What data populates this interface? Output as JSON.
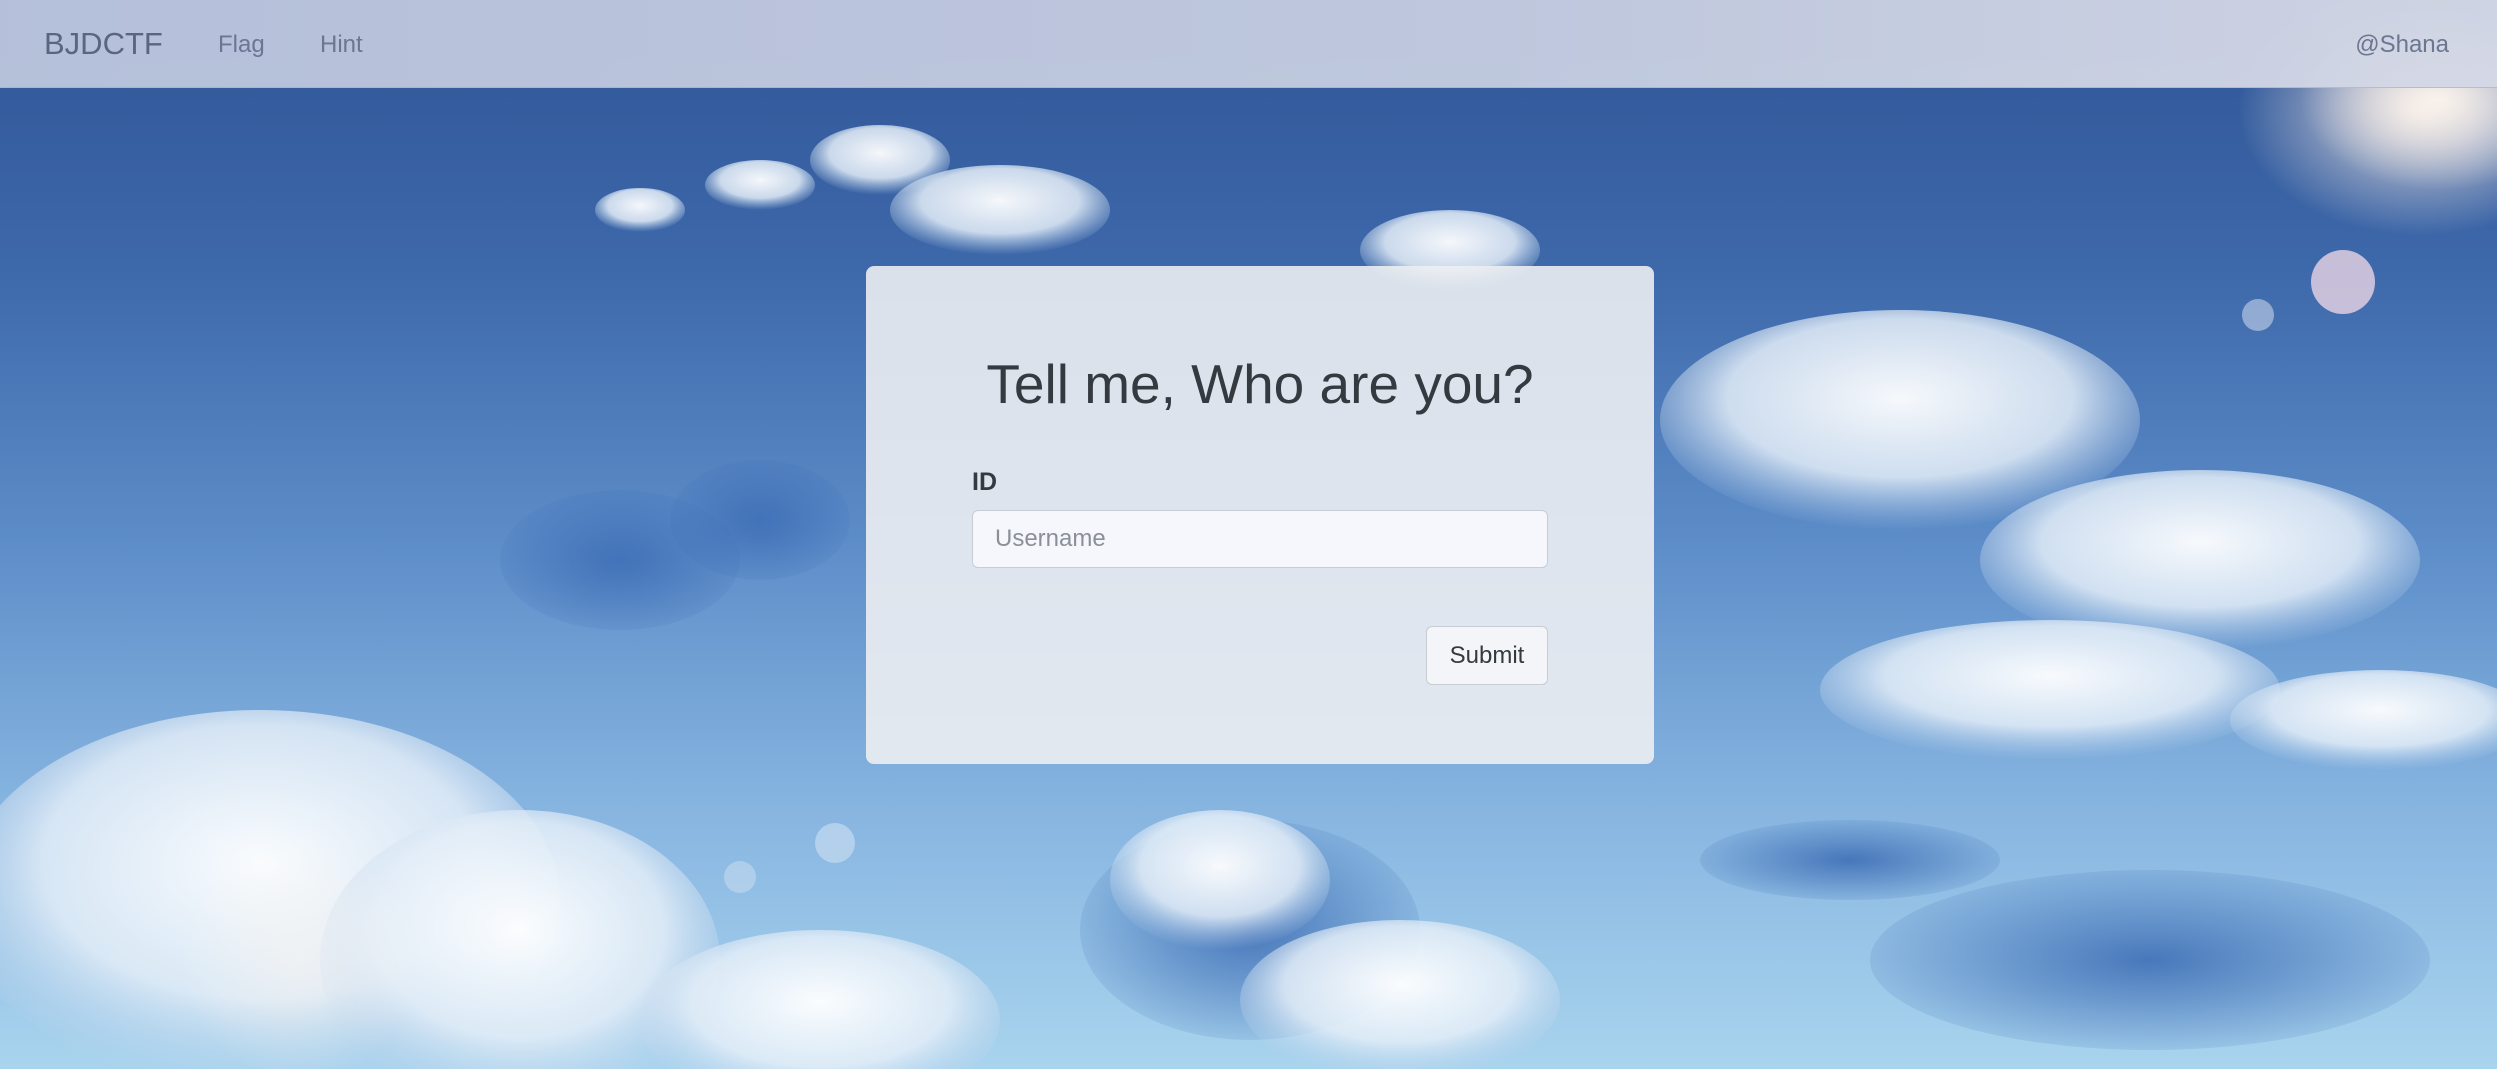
{
  "navbar": {
    "brand": "BJDCTF",
    "links": [
      {
        "label": "Flag"
      },
      {
        "label": "Hint"
      }
    ],
    "user": "@Shana"
  },
  "form": {
    "title": "Tell me, Who are you?",
    "id_label": "ID",
    "username_placeholder": "Username",
    "username_value": "",
    "submit_label": "Submit"
  },
  "colors": {
    "sky_top": "#2f5596",
    "sky_bottom": "#a9d4ee",
    "navbar_bg": "#c0c8dc",
    "card_bg": "#eceef2",
    "text_dark": "#343a40"
  }
}
